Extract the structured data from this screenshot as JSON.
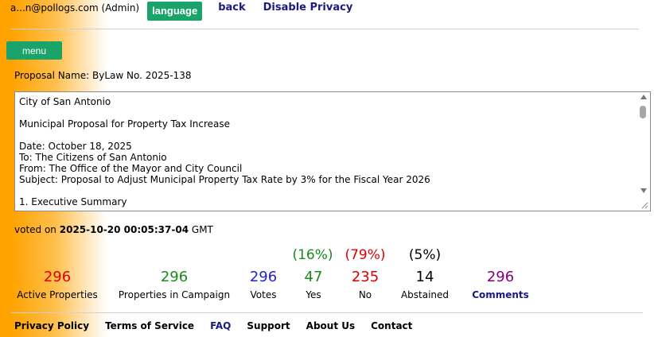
{
  "header": {
    "user": "a...n@pollogs.com (Admin)",
    "language_label": "language",
    "back_label": "back",
    "privacy_label": "Disable Privacy"
  },
  "menu_label": "menu",
  "proposal": {
    "name_label": "Proposal Name:",
    "name": "ByLaw No. 2025-138",
    "text_lines": [
      "City of San Antonio",
      "",
      "Municipal Proposal for Property Tax Increase",
      "",
      "Date: October 18, 2025",
      "To: The Citizens of San Antonio",
      "From: The Office of the Mayor and City Council",
      "Subject: Proposal to Adjust Municipal Property Tax Rate by 3% for the Fiscal Year 2026",
      "",
      "1. Executive Summary"
    ]
  },
  "voted": {
    "prefix": "voted on",
    "datetime": "2025-10-20 00:05:37-04",
    "tz": "GMT"
  },
  "stats": {
    "active_properties": {
      "value": "296",
      "label": "Active Properties",
      "color": "#e00000"
    },
    "properties_in_campaign": {
      "value": "296",
      "label": "Properties in Campaign",
      "color": "#1a8a1a"
    },
    "votes": {
      "value": "296",
      "label": "Votes",
      "color": "#2222cc"
    },
    "yes": {
      "value": "47",
      "label": "Yes",
      "pct": "(16%)",
      "color": "#1a8a1a"
    },
    "no": {
      "value": "235",
      "label": "No",
      "pct": "(79%)",
      "color": "#e00000"
    },
    "abstained": {
      "value": "14",
      "label": "Abstained",
      "pct": "(5%)",
      "color": "#000000"
    },
    "comments": {
      "value": "296",
      "label": "Comments",
      "color": "#800080"
    }
  },
  "footer": {
    "privacy": "Privacy Policy",
    "terms": "Terms of Service",
    "faq": "FAQ",
    "support": "Support",
    "about": "About Us",
    "contact": "Contact"
  }
}
